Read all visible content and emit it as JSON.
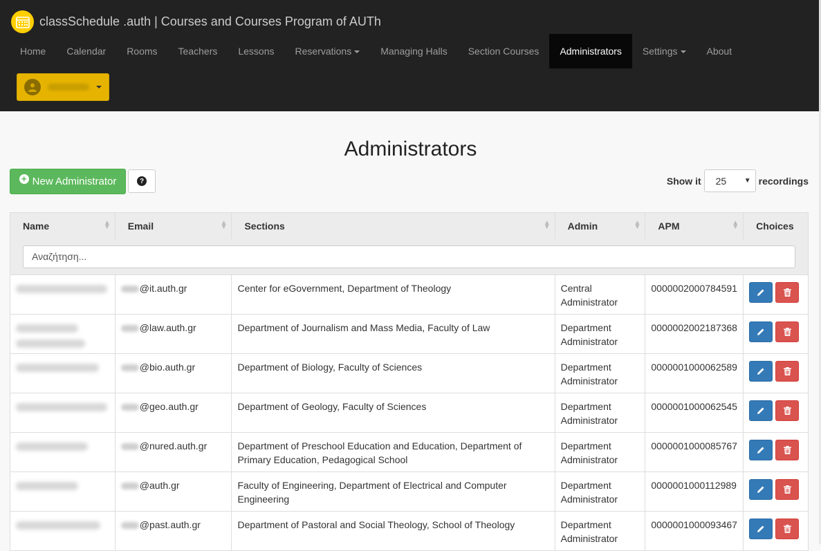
{
  "app": {
    "title": "classSchedule .auth | Courses and Courses Program of AUTh",
    "accent": "#ffcf00"
  },
  "nav": {
    "home": "Home",
    "calendar": "Calendar",
    "rooms": "Rooms",
    "teachers": "Teachers",
    "lessons": "Lessons",
    "reservations": "Reservations",
    "managing_halls": "Managing Halls",
    "section_courses": "Section Courses",
    "administrators": "Administrators",
    "settings": "Settings",
    "about": "About"
  },
  "page": {
    "title": "Administrators",
    "new_button": "New Administrator",
    "show_label": "Show it",
    "page_size": "25",
    "recordings_label": "recordings",
    "search_placeholder": "Αναζήτηση..."
  },
  "table": {
    "headers": {
      "name": "Name",
      "email": "Email",
      "sections": "Sections",
      "admin": "Admin",
      "apm": "APM",
      "choices": "Choices"
    },
    "rows": [
      {
        "name": "",
        "email": "@it.auth.gr",
        "sections": "Center for eGovernment, Department of Theology",
        "admin": "Central Administrator",
        "apm": "0000002000784591"
      },
      {
        "name": "",
        "email": "@law.auth.gr",
        "sections": "Department of Journalism and Mass Media, Faculty of Law",
        "admin": "Department Administrator",
        "apm": "0000002002187368"
      },
      {
        "name": "",
        "email": "@bio.auth.gr",
        "sections": "Department of Biology, Faculty of Sciences",
        "admin": "Department Administrator",
        "apm": "0000001000062589"
      },
      {
        "name": "",
        "email": "@geo.auth.gr",
        "sections": "Department of Geology, Faculty of Sciences",
        "admin": "Department Administrator",
        "apm": "0000001000062545"
      },
      {
        "name": "",
        "email": "@nured.auth.gr",
        "sections": "Department of Preschool Education and Education, Department of Primary Education, Pedagogical School",
        "admin": "Department Administrator",
        "apm": "0000001000085767"
      },
      {
        "name": "",
        "email": "@auth.gr",
        "sections": "Faculty of Engineering, Department of Electrical and Computer Engineering",
        "admin": "Department Administrator",
        "apm": "0000001000112989"
      },
      {
        "name": "",
        "email": "@past.auth.gr",
        "sections": "Department of Pastoral and Social Theology, School of Theology",
        "admin": "Department Administrator",
        "apm": "0000001000093467"
      }
    ]
  },
  "icons": {
    "logo": "calendar-icon",
    "user": "user-icon",
    "plus": "plus-circle-icon",
    "help": "question-circle-icon",
    "edit": "pencil-icon",
    "delete": "trash-icon"
  }
}
